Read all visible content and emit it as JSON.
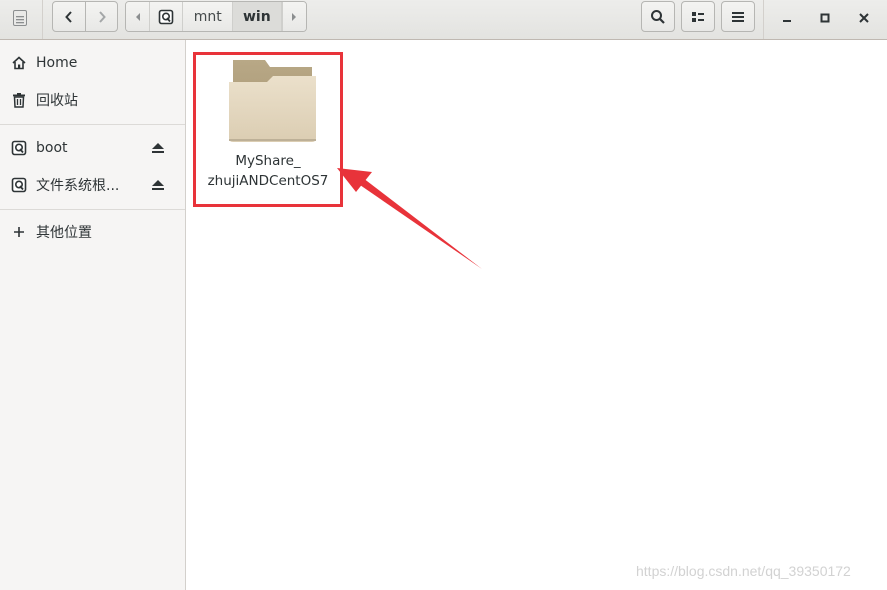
{
  "toolbar": {
    "back_tooltip": "back",
    "forward_tooltip": "forward"
  },
  "pathbar": {
    "segments": [
      {
        "label": "mnt"
      },
      {
        "label": "win"
      }
    ]
  },
  "sidebar": {
    "items": [
      {
        "label": "Home",
        "icon": "home-icon"
      },
      {
        "label": "回收站",
        "icon": "trash-icon"
      },
      {
        "label": "boot",
        "icon": "drive-icon"
      },
      {
        "label": "文件系统根...",
        "icon": "drive-icon"
      },
      {
        "label": "其他位置",
        "icon": "plus-icon"
      }
    ]
  },
  "files": [
    {
      "name_line1": "MyShare_",
      "name_line2": "zhujiANDCentOS7",
      "icon": "folder-icon"
    }
  ],
  "colors": {
    "highlight": "#e8333a",
    "folder": "#d6c9b0"
  },
  "watermark": "https://blog.csdn.net/qq_39350172"
}
